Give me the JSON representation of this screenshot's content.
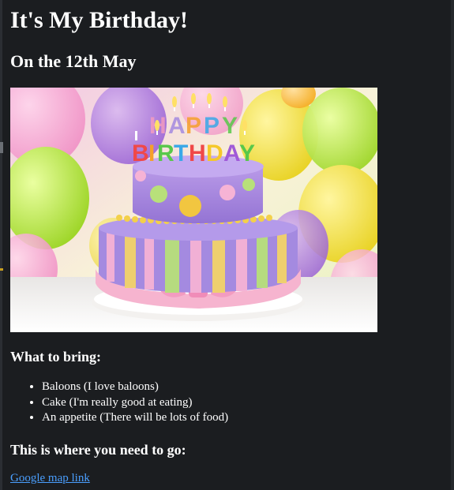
{
  "page": {
    "title": "It's My Birthday!",
    "subtitle": "On the 12th May"
  },
  "image": {
    "description_icon": "birthday-cake-photo",
    "candle_letters_top": [
      "H",
      "A",
      "P",
      "P",
      "Y"
    ],
    "candle_letters_bottom": [
      "B",
      "I",
      "R",
      "T",
      "H",
      "D",
      "A",
      "Y"
    ]
  },
  "bring": {
    "heading": "What to bring:",
    "items": [
      "Baloons (I love baloons)",
      "Cake (I'm really good at eating)",
      "An appetite (There will be lots of food)"
    ]
  },
  "location": {
    "heading": "This is where you need to go:",
    "link_text": "Google map link"
  },
  "colors": {
    "background": "#1b1d20",
    "text": "#ffffff",
    "link": "#4a9fff"
  }
}
